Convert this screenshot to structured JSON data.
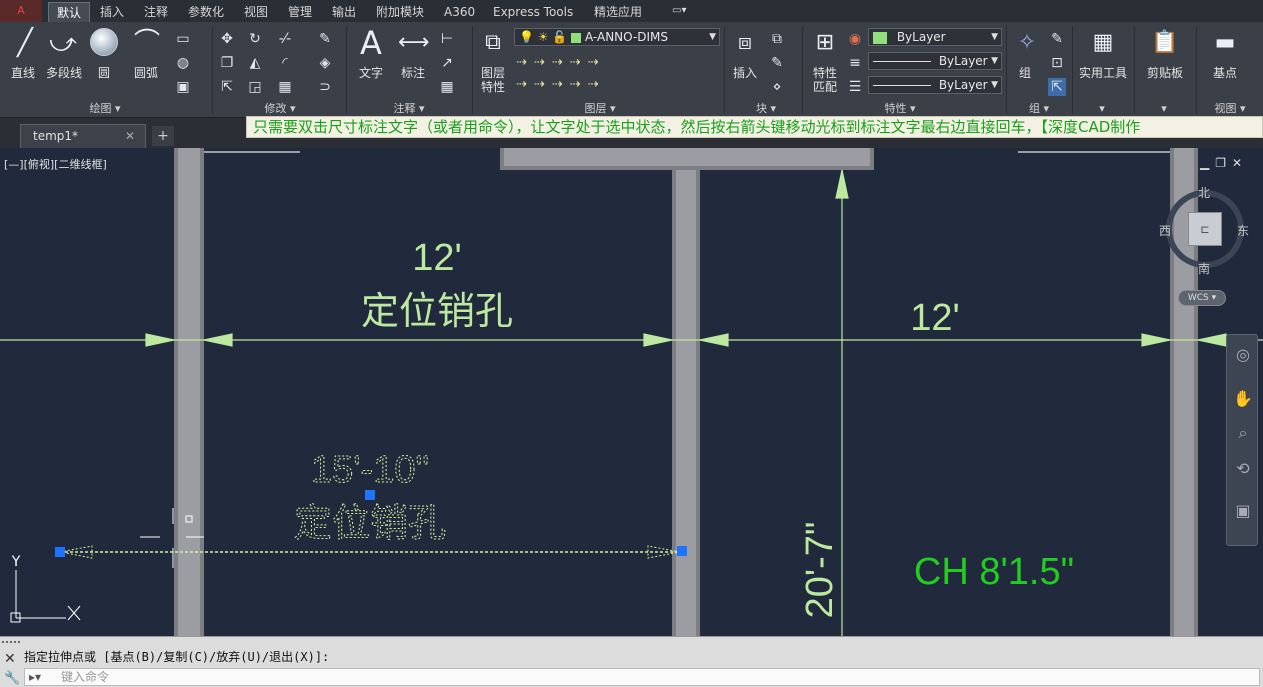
{
  "ribbon_tabs": [
    "默认",
    "插入",
    "注释",
    "参数化",
    "视图",
    "管理",
    "输出",
    "附加模块",
    "A360",
    "Express Tools",
    "精选应用"
  ],
  "active_tab": "默认",
  "draw_panel": {
    "title": "绘图 ▾",
    "line": "直线",
    "polyline": "多段线",
    "circle": "圆",
    "arc": "圆弧"
  },
  "modify_panel": {
    "title": "修改 ▾"
  },
  "annotation_panel": {
    "title": "注释 ▾",
    "text": "文字",
    "dimension": "标注"
  },
  "layers_panel": {
    "title": "图层 ▾",
    "layer_props": "图层\n特性",
    "current_layer": "A-ANNO-DIMS"
  },
  "block_panel": {
    "title": "块 ▾",
    "insert": "插入"
  },
  "properties_panel": {
    "title": "特性 ▾",
    "match": "特性\n匹配",
    "color": "ByLayer",
    "linetype": "ByLayer",
    "lineweight": "ByLayer"
  },
  "groups_panel": {
    "title": "组 ▾",
    "group": "组"
  },
  "utilities": {
    "label": "实用工具"
  },
  "clipboard": {
    "label": "剪贴板"
  },
  "view_panel": {
    "title": "视图 ▾",
    "base": "基点"
  },
  "doc_tab": {
    "name": "temp1*"
  },
  "notice": "只需要双击尺寸标注文字（或者用命令），让文字处于选中状态，然后按右箭头键移动光标到标注文字最右边直接回车，【深度CAD制作",
  "viewport_label": "[—][俯视][二维线框]",
  "viewcube": {
    "north": "北",
    "south": "南",
    "east": "东",
    "west": "西",
    "wcs": "WCS"
  },
  "drawing": {
    "dim1_value": "12'",
    "dim1_note": "定位销孔",
    "dim2_value": "12'",
    "dim3_value": "15'-10\"",
    "dim3_note": "定位销孔",
    "vertical_dim": "20'-7\"",
    "ceiling": "CH 8'1.5\"",
    "ucs_x": "X",
    "ucs_y": "Y"
  },
  "command": {
    "history": "指定拉伸点或 [基点(B)/复制(C)/放弃(U)/退出(X)]:",
    "placeholder": "键入命令"
  },
  "colors": {
    "dim": "#bde8a0",
    "green_text": "#22cc22",
    "wall": "#7c7e82",
    "background": "#212a3c"
  }
}
